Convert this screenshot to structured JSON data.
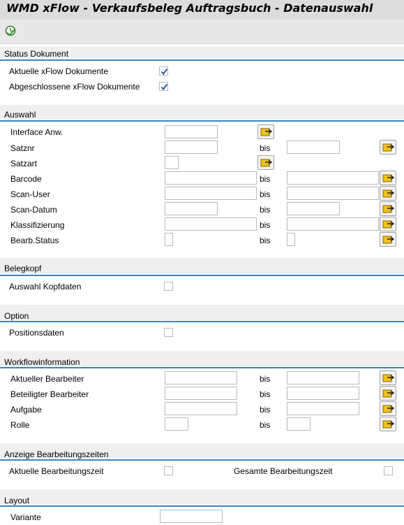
{
  "title": "WMD xFlow - Verkaufsbeleg Auftragsbuch - Datenauswahl",
  "toolbar": {
    "execute_icon": "execute-clock-icon"
  },
  "status": {
    "title": "Status Dokument",
    "aktuelle": {
      "label": "Aktuelle xFlow Dokumente",
      "checked": true
    },
    "abgeschlossene": {
      "label": "Abgeschlossene xFlow Dokumente",
      "checked": true
    }
  },
  "auswahl": {
    "title": "Auswahl",
    "bis": "bis",
    "fields": [
      {
        "label": "Interface Anw.",
        "from": "",
        "to": null
      },
      {
        "label": "Satznr",
        "from": "",
        "to": ""
      },
      {
        "label": "Satzart",
        "from": "",
        "to": null
      },
      {
        "label": "Barcode",
        "from": "",
        "to": ""
      },
      {
        "label": "Scan-User",
        "from": "",
        "to": ""
      },
      {
        "label": "Scan-Datum",
        "from": "",
        "to": ""
      },
      {
        "label": "Klassifizierung",
        "from": "",
        "to": ""
      },
      {
        "label": "Bearb.Status",
        "from": "",
        "to": ""
      }
    ]
  },
  "belegkopf": {
    "title": "Belegkopf",
    "label": "Auswahl Kopfdaten",
    "checked": false
  },
  "option": {
    "title": "Option",
    "label": "Positionsdaten",
    "checked": false
  },
  "workflow": {
    "title": "Workflowinformation",
    "bis": "bis",
    "fields": [
      {
        "label": "Aktueller Bearbeiter",
        "from": "",
        "to": ""
      },
      {
        "label": "Beteiligter Bearbeiter",
        "from": "",
        "to": ""
      },
      {
        "label": "Aufgabe",
        "from": "",
        "to": ""
      },
      {
        "label": "Rolle",
        "from": "",
        "to": ""
      }
    ]
  },
  "zeiten": {
    "title": "Anzeige Bearbeitungszeiten",
    "aktuelle": {
      "label": "Aktuelle Bearbeitungszeit",
      "checked": false
    },
    "gesamte": {
      "label": "Gesamte Bearbeitungszeit",
      "checked": false
    }
  },
  "layout": {
    "title": "Layout",
    "label": "Variante",
    "value": ""
  },
  "colors": {
    "accent_line": "#3a84bf",
    "band": "#efefef",
    "title_bar": "#dcdcdc",
    "check_blue": "#1f5fa8",
    "arrow_yellow": "#f0c020"
  }
}
